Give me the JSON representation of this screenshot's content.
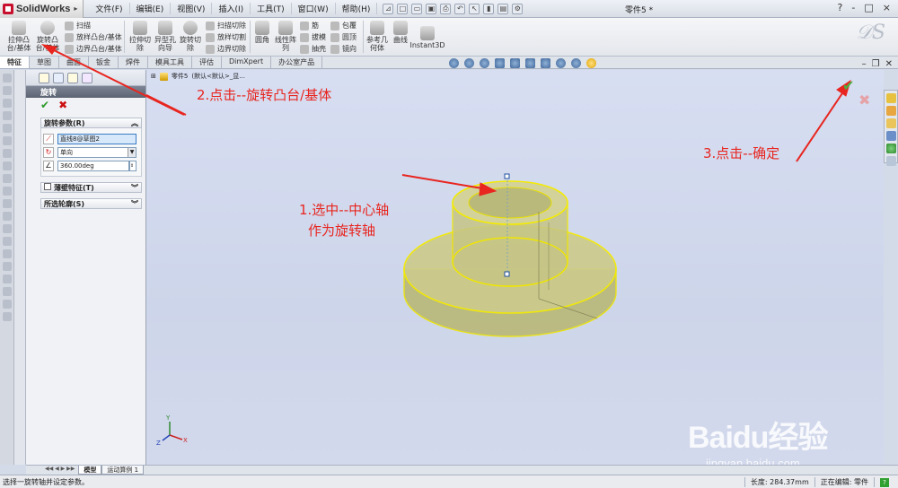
{
  "app": {
    "name": "SolidWorks",
    "doc_title": "零件5 *",
    "window_controls": [
      "?",
      "-",
      "□",
      "×"
    ]
  },
  "menu": [
    "文件(F)",
    "编辑(E)",
    "视图(V)",
    "插入(I)",
    "工具(T)",
    "窗口(W)",
    "帮助(H)"
  ],
  "ribbon": {
    "extrude_boss": "拉伸凸\n台/基体",
    "revolve_boss": "旋转凸\n台/基体",
    "sweep": "扫描",
    "loft_boss": "放样凸台/基体",
    "boundary_boss": "边界凸台/基体",
    "extrude_cut": "拉伸切\n除",
    "hole_wizard": "异型孔\n向导",
    "revolve_cut": "旋转切\n除",
    "sweep_cut": "扫描切除",
    "loft_cut": "放样切割",
    "boundary_cut": "边界切除",
    "fillet": "圆角",
    "linear_pattern": "线性阵\n列",
    "rib": "筋",
    "draft": "拔模",
    "shell": "抽壳",
    "wrap": "包覆",
    "dome": "圆顶",
    "mirror": "镜向",
    "ref_geometry": "参考几\n何体",
    "curves": "曲线",
    "instant3d": "Instant3D"
  },
  "tabs": [
    "特征",
    "草图",
    "曲面",
    "钣金",
    "焊件",
    "模具工具",
    "评估",
    "DimXpert",
    "办公室产品"
  ],
  "tree": {
    "part": "零件5",
    "config": "(默认<默认>_显..."
  },
  "property_manager": {
    "title": "旋转",
    "params_group": "旋转参数(R)",
    "axis_value": "直线8@草图2",
    "direction_value": "单向",
    "angle_value": "360.00deg",
    "thin_feature": "薄壁特征(T)",
    "selected_contours": "所选轮廓(S)"
  },
  "annotations": {
    "step1_line1": "1.选中--中心轴",
    "step1_line2": "作为旋转轴",
    "step2": "2.点击--旋转凸台/基体",
    "step3": "3.点击--确定"
  },
  "bottom_tabs": [
    "模型",
    "运动算例 1"
  ],
  "status": {
    "message": "选择一旋转轴并设定参数。",
    "length_label": "长度: 284.37mm",
    "editing": "正在编辑: 零件"
  },
  "watermark": {
    "main": "Baidu经验",
    "url": "jingyan.baidu.com"
  },
  "colors": {
    "annotation": "#e8251f",
    "model_fill": "#c8c98a",
    "model_edge": "#f0e600",
    "viewport": "#d0d7ec"
  }
}
